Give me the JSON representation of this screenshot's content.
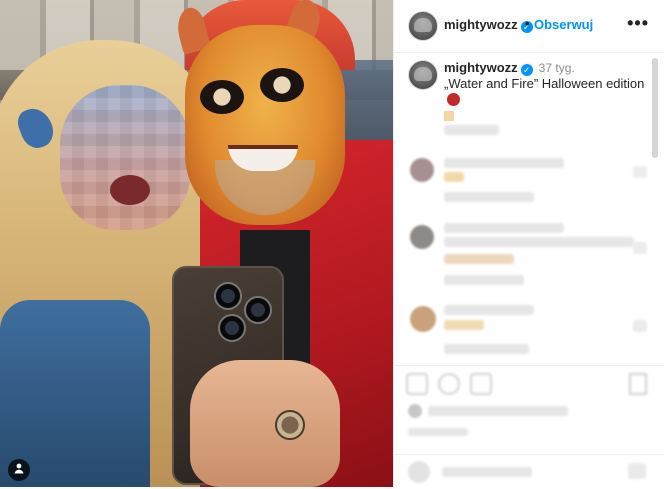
{
  "post": {
    "photo_alt": "",
    "tag_icon": "person-icon"
  },
  "header": {
    "username": "mightywozz",
    "verified_icon": "verified-badge-icon",
    "separator": "•",
    "follow_label": "Obserwuj",
    "more_label": "•••"
  },
  "caption": {
    "username": "mightywozz",
    "time": "37 tyg.",
    "text": "„Water and Fire” Halloween edition"
  },
  "colors": {
    "accent": "#0095f6",
    "text": "#262626",
    "muted": "#8e8e8e"
  }
}
